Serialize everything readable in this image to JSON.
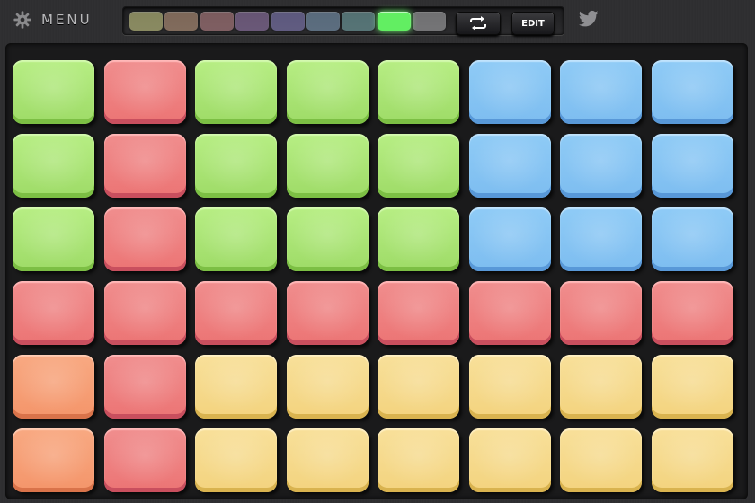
{
  "header": {
    "menu_icon": "gear-icon",
    "menu_label": "MENU",
    "loop_icon": "repeat-icon",
    "edit_label": "EDIT",
    "share_icon": "twitter-icon"
  },
  "banks": [
    {
      "color": "#d8d98e",
      "active": false
    },
    {
      "color": "#c9a285",
      "active": false
    },
    {
      "color": "#c58b8f",
      "active": false
    },
    {
      "color": "#9f7fb6",
      "active": false
    },
    {
      "color": "#8e86c7",
      "active": false
    },
    {
      "color": "#86a6c4",
      "active": false
    },
    {
      "color": "#7cb1b3",
      "active": false
    },
    {
      "color": "#62ee62",
      "active": true
    },
    {
      "color": "#b2b2b4",
      "active": false
    }
  ],
  "pads": [
    [
      "green",
      "red",
      "green",
      "green",
      "green",
      "blue",
      "blue",
      "blue"
    ],
    [
      "green",
      "red",
      "green",
      "green",
      "green",
      "blue",
      "blue",
      "blue"
    ],
    [
      "green",
      "red",
      "green",
      "green",
      "green",
      "blue",
      "blue",
      "blue"
    ],
    [
      "red",
      "red",
      "red",
      "red",
      "red",
      "red",
      "red",
      "red"
    ],
    [
      "orange",
      "red",
      "yellow",
      "yellow",
      "yellow",
      "yellow",
      "yellow",
      "yellow"
    ],
    [
      "orange",
      "red",
      "yellow",
      "yellow",
      "yellow",
      "yellow",
      "yellow",
      "yellow"
    ]
  ]
}
